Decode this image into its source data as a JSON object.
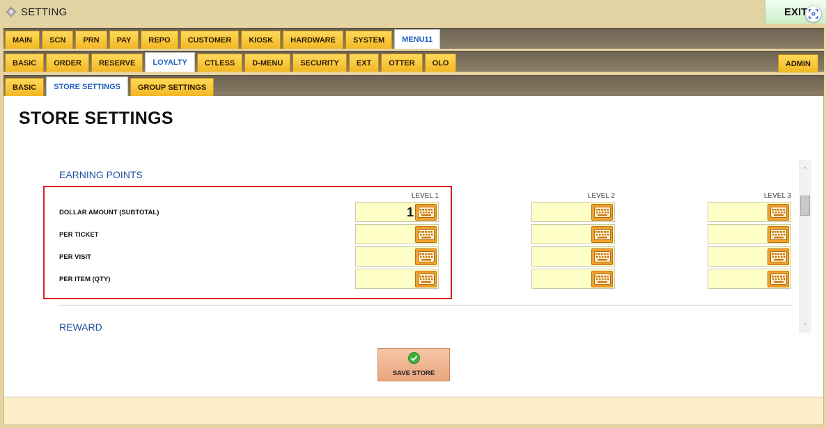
{
  "window": {
    "title": "SETTING",
    "exit_label": "EXIT"
  },
  "tabs_main": [
    "MAIN",
    "SCN",
    "PRN",
    "PAY",
    "REPO",
    "CUSTOMER",
    "KIOSK",
    "HARDWARE",
    "SYSTEM",
    "MENU11"
  ],
  "tabs_main_active": "MENU11",
  "tabs_sub": [
    "BASIC",
    "ORDER",
    "RESERVE",
    "LOYALTY",
    "CTLESS",
    "D-MENU",
    "SECURITY",
    "EXT",
    "OTTER",
    "OLO"
  ],
  "tabs_sub_active": "LOYALTY",
  "admin_label": "ADMIN",
  "tabs_third": [
    "BASIC",
    "STORE SETTINGS",
    "GROUP SETTINGS"
  ],
  "tabs_third_active": "STORE SETTINGS",
  "page_title": "STORE SETTINGS",
  "earning": {
    "header": "EARNING POINTS",
    "levels": [
      "LEVEL 1",
      "LEVEL 2",
      "LEVEL 3"
    ],
    "rows": [
      {
        "label": "DOLLAR AMOUNT (SUBTOTAL)",
        "values": [
          "1",
          "",
          ""
        ]
      },
      {
        "label": "PER TICKET",
        "values": [
          "",
          "",
          ""
        ]
      },
      {
        "label": "PER VISIT",
        "values": [
          "",
          "",
          ""
        ]
      },
      {
        "label": "PER ITEM (QTY)",
        "values": [
          "",
          "",
          ""
        ]
      }
    ]
  },
  "reward": {
    "header": "REWARD"
  },
  "save_button": {
    "label": "SAVE STORE"
  },
  "colors": {
    "tab": "#f2b724",
    "active_tab_text": "#1d5fbf",
    "field": "#ffffc8",
    "keyboard": "#f0a22c",
    "highlight": "#e02020"
  }
}
